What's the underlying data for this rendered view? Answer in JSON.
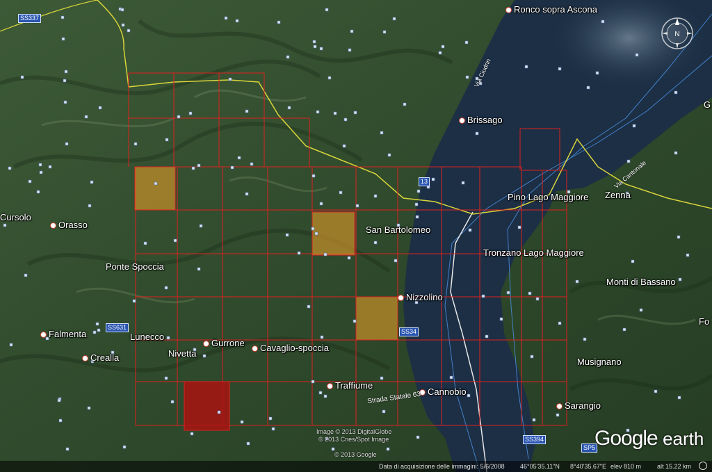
{
  "places": [
    {
      "key": "ronco",
      "label": "Ronco sopra Ascona"
    },
    {
      "key": "brissago",
      "label": "Brissago"
    },
    {
      "key": "pino",
      "label": "Pino Lago Maggiore"
    },
    {
      "key": "zenna",
      "label": "Zenna"
    },
    {
      "key": "sanbart",
      "label": "San Bartolomeo"
    },
    {
      "key": "tronzano",
      "label": "Tronzano Lago Maggiore"
    },
    {
      "key": "monti",
      "label": "Monti di Bassano"
    },
    {
      "key": "nizzolino",
      "label": "Nizzolino"
    },
    {
      "key": "cursolo",
      "label": "Cursolo"
    },
    {
      "key": "orasso",
      "label": "Orasso"
    },
    {
      "key": "ponte",
      "label": "Ponte Spoccia"
    },
    {
      "key": "falmenta",
      "label": "Falmenta"
    },
    {
      "key": "lunecco",
      "label": "Lunecco"
    },
    {
      "key": "crealla",
      "label": "Crealla"
    },
    {
      "key": "nivetta",
      "label": "Nivetta"
    },
    {
      "key": "gurrone",
      "label": "Gurrone"
    },
    {
      "key": "cavaglio",
      "label": "Cavaglio-spoccia"
    },
    {
      "key": "traffiume",
      "label": "Traffiume"
    },
    {
      "key": "cannobio",
      "label": "Cannobio"
    },
    {
      "key": "musignano",
      "label": "Musignano"
    },
    {
      "key": "sarangio",
      "label": "Sarangio"
    },
    {
      "key": "fo",
      "label": "Fo"
    },
    {
      "key": "g",
      "label": "G"
    }
  ],
  "road_labels": {
    "ss337": "SS337",
    "r13": "13",
    "ss631": "SS631",
    "ss34": "SS34",
    "ss394": "SS394",
    "sp5": "SP5",
    "strada_statale": "Strada Statale 63",
    "via_cantonale": "Via Cantonale",
    "via_ciudrin": "Via Ciudrin"
  },
  "credits": {
    "digitalglobe": "Image © 2013 DigitalGlobe",
    "cnes": "© 2013 Cnes/Spot Image",
    "google": "© 2013 Google"
  },
  "logo": {
    "google": "Google",
    "earth": "earth"
  },
  "status": {
    "acquisition": "Data di acquisizione delle immagini: 5/6/2008",
    "lat": "46°05'35.11\"N",
    "lon": "8°40'35.67\"E",
    "elev": "elev  810 m",
    "alt": "alt  15.22 km"
  },
  "compass_n": "N",
  "colors": {
    "grid": "#e02020",
    "highlight_orange": "#c8902a",
    "highlight_red": "#b01010",
    "lake": "#1c2f45",
    "border": "#d9d43a"
  }
}
